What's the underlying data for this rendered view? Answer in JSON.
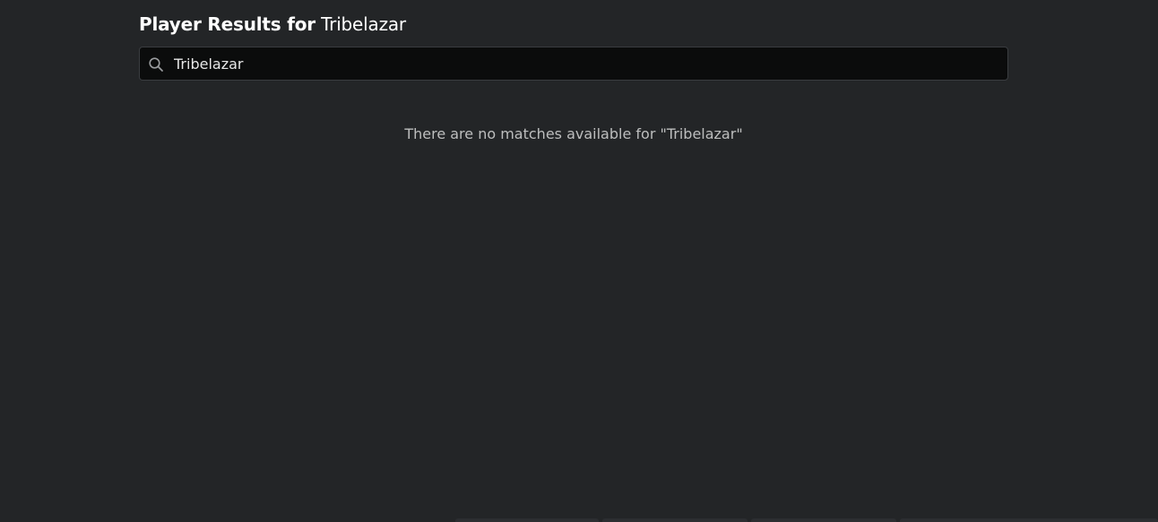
{
  "header": {
    "title_prefix": "Player Results for",
    "query": "Tribelazar"
  },
  "search": {
    "value": "Tribelazar",
    "placeholder": "",
    "icon": "search-icon"
  },
  "results": {
    "empty_message": "There are no matches available for \"Tribelazar\""
  },
  "colors": {
    "background": "#232527",
    "input_background": "#0b0c0c",
    "input_border": "#3a3d40",
    "title_text": "#ffffff",
    "muted_text": "#bdbebe"
  }
}
